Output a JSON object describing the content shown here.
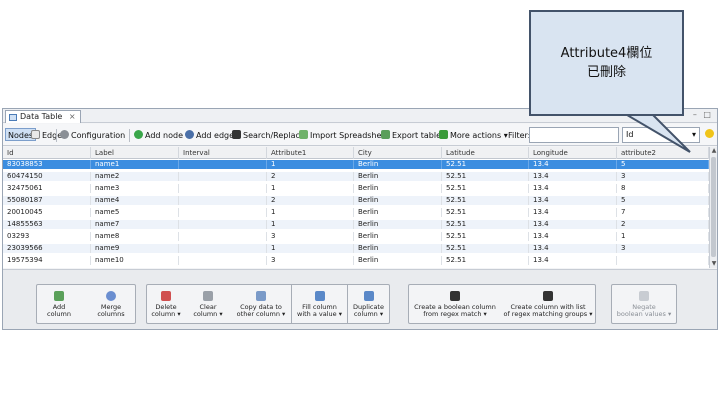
{
  "callout": {
    "line1": "Attribute4欄位",
    "line2": "已刪除"
  },
  "window": {
    "tab_title": "Data Table",
    "tab_close": "×",
    "controls": "– □"
  },
  "toolbar": {
    "nodes": "Nodes",
    "edges": "Edges",
    "configuration": "Configuration",
    "add_node": "Add node",
    "add_edge": "Add edge",
    "search_replace": "Search/Replace",
    "import_spreadsheet": "Import Spreadsheet",
    "export_table": "Export table",
    "more_actions": "More actions",
    "more_actions_arrow": "▾",
    "filter_label": "Filter:",
    "filter_value": "",
    "column_select": "Id",
    "column_select_arrow": "▾"
  },
  "table": {
    "headers": [
      "Id",
      "Label",
      "Interval",
      "Attribute1",
      "City",
      "Latitude",
      "Longitude",
      "attribute2"
    ],
    "rows": [
      [
        "83038853",
        "name1",
        "",
        "1",
        "Berlin",
        "52.51",
        "13.4",
        "5"
      ],
      [
        "60474150",
        "name2",
        "",
        "2",
        "Berlin",
        "52.51",
        "13.4",
        "3"
      ],
      [
        "32475061",
        "name3",
        "",
        "1",
        "Berlin",
        "52.51",
        "13.4",
        "8"
      ],
      [
        "55080187",
        "name4",
        "",
        "2",
        "Berlin",
        "52.51",
        "13.4",
        "5"
      ],
      [
        "20010045",
        "name5",
        "",
        "1",
        "Berlin",
        "52.51",
        "13.4",
        "7"
      ],
      [
        "14855563",
        "name7",
        "",
        "1",
        "Berlin",
        "52.51",
        "13.4",
        "2"
      ],
      [
        "03293",
        "name8",
        "",
        "3",
        "Berlin",
        "52.51",
        "13.4",
        "1"
      ],
      [
        "23039566",
        "name9",
        "",
        "1",
        "Berlin",
        "52.51",
        "13.4",
        "3"
      ],
      [
        "19575394",
        "name10",
        "",
        "3",
        "Berlin",
        "52.51",
        "13.4",
        ""
      ]
    ],
    "selected_row": 0
  },
  "panel": {
    "add_column": [
      "Add",
      "column"
    ],
    "merge_columns": [
      "Merge",
      "columns"
    ],
    "delete_column": [
      "Delete",
      "column ▾"
    ],
    "clear_column": [
      "Clear",
      "column ▾"
    ],
    "copy_data": [
      "Copy data to",
      "other column ▾"
    ],
    "fill_column": [
      "Fill column",
      "with a value ▾"
    ],
    "duplicate_column": [
      "Duplicate",
      "column ▾"
    ],
    "create_boolean": [
      "Create a boolean column",
      "from regex match ▾"
    ],
    "create_list": [
      "Create column with list",
      "of regex matching groups ▾"
    ],
    "negate_boolean": [
      "Negate",
      "boolean values ▾"
    ]
  },
  "colors": {
    "selection": "#3b8de0",
    "alt_row": "#eef3fa",
    "callout_fill": "#d9e4f1",
    "callout_border": "#43536a"
  }
}
